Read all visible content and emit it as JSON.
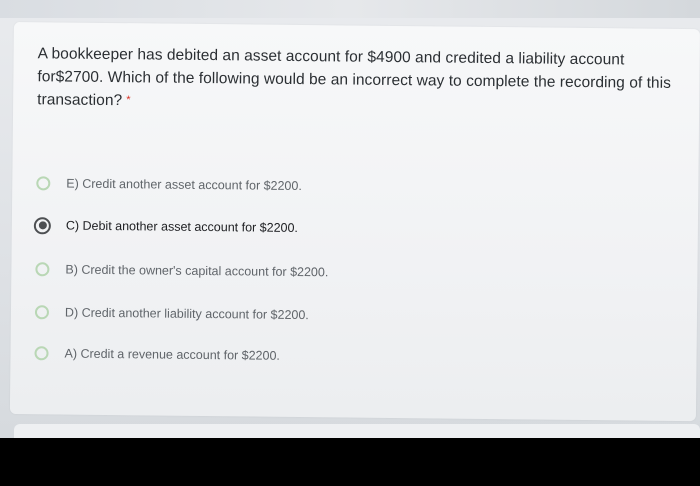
{
  "question": {
    "text": "A bookkeeper has debited an asset account for $4900 and credited a liability account for$2700. Which of the following would be an incorrect way to complete the recording of this transaction?",
    "required_marker": "*"
  },
  "options": [
    {
      "label": "E) Credit another asset account for $2200.",
      "selected": false
    },
    {
      "label": "C) Debit another asset account for $2200.",
      "selected": true
    },
    {
      "label": "B) Credit the owner's capital account for $2200.",
      "selected": false
    },
    {
      "label": "D) Credit another liability account for $2200.",
      "selected": false
    },
    {
      "label": "A) Credit a revenue account for $2200.",
      "selected": false
    }
  ],
  "colors": {
    "radio_unselected": "#b9d7b5",
    "radio_selected": "#4d4f52",
    "required": "#d93025"
  }
}
